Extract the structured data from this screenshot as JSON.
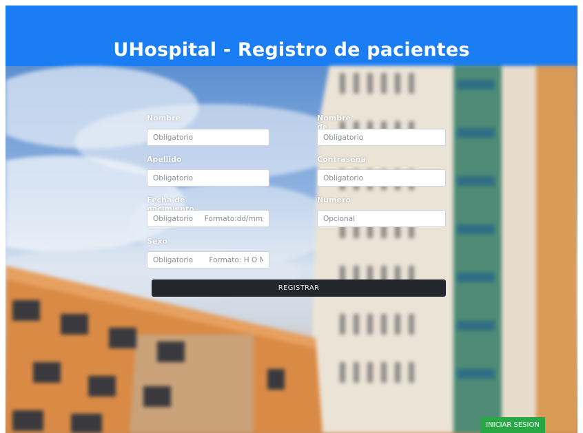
{
  "header": {
    "title": "UHospital - Registro de pacientes"
  },
  "form": {
    "nombre": {
      "label": "Nombre",
      "placeholder": "Obligatorio"
    },
    "usuario": {
      "label": "Nombre de usuario",
      "placeholder": "Obligatorio"
    },
    "apellido": {
      "label": "Apellido",
      "placeholder": "Obligatorio"
    },
    "contrasena": {
      "label": "Contraseña",
      "placeholder": "Obligatorio"
    },
    "fecha": {
      "label": "Fecha de nacimiento",
      "placeholder": "Obligatorio     Formato:dd/mm/y"
    },
    "numero": {
      "label": "Numero",
      "placeholder": "Opcional"
    },
    "sexo": {
      "label": "Sexo",
      "placeholder": "Obligatorio       Formato: H O M"
    }
  },
  "buttons": {
    "register": "REGISTRAR",
    "login": "INICIAR SESION"
  },
  "colors": {
    "header": "#1a7df3",
    "register_button": "#23272b",
    "login_button": "#28a745"
  }
}
